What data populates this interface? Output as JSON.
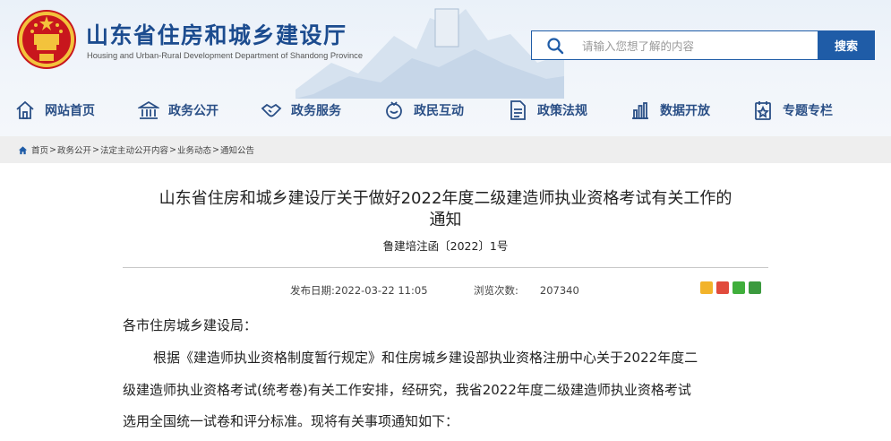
{
  "header": {
    "site_title": "山东省住房和城乡建设厅",
    "site_subtitle": "Housing and Urban-Rural Development Department of Shandong Province",
    "emblem": "national-emblem-icon",
    "search": {
      "placeholder": "请输入您想了解的内容",
      "button_label": "搜索",
      "icon": "search-icon"
    }
  },
  "nav": {
    "items": [
      {
        "label": "网站首页",
        "icon": "home-icon"
      },
      {
        "label": "政务公开",
        "icon": "government-building-icon"
      },
      {
        "label": "政务服务",
        "icon": "handshake-icon"
      },
      {
        "label": "政民互动",
        "icon": "interaction-icon"
      },
      {
        "label": "政策法规",
        "icon": "document-icon"
      },
      {
        "label": "数据开放",
        "icon": "bar-chart-icon"
      },
      {
        "label": "专题专栏",
        "icon": "special-topic-icon"
      }
    ]
  },
  "breadcrumb": {
    "items": [
      "首页",
      "政务公开",
      "法定主动公开内容",
      "业务动态",
      "通知公告"
    ],
    "separator": ">"
  },
  "article": {
    "title_line1": "山东省住房和城乡建设厅关于做好2022年度二级建造师执业资格考试有关工作的",
    "title_line2": "通知",
    "doc_number": "鲁建培注函〔2022〕1号",
    "publish_label": "发布日期:",
    "publish_date": "2022-03-22 11:05",
    "views_label": "浏览次数:",
    "views": "207340",
    "salutation": "各市住房城乡建设局：",
    "para1_line1": "根据《建造师执业资格制度暂行规定》和住房城乡建设部执业资格注册中心关于2022年度二",
    "para1_line2": "级建造师执业资格考试(统考卷)有关工作安排，经研究，我省2022年度二级建造师执业资格考试",
    "para1_line3": "选用全国统一试卷和评分标准。现将有关事项通知如下："
  },
  "share_icons": [
    "qzone-share-icon",
    "weibo-share-icon",
    "wechat-share-icon",
    "douban-share-icon"
  ],
  "colors": {
    "brand_blue": "#1f5ca7",
    "nav_text": "#2a4f86",
    "title_blue": "#1c4c8f"
  }
}
